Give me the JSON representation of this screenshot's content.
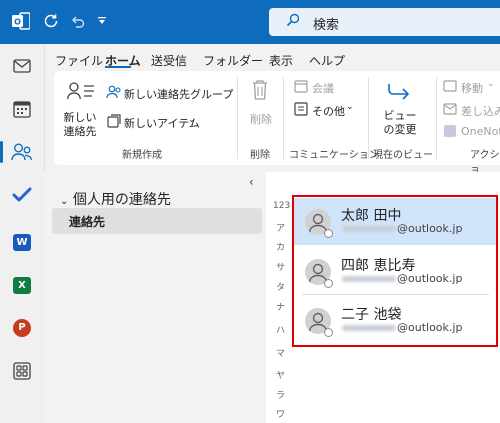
{
  "titlebar": {
    "search_label": "検索"
  },
  "menu": {
    "tabs": [
      "ファイル",
      "ホーム",
      "送受信",
      "フォルダー",
      "表示",
      "ヘルプ"
    ],
    "active": "ホーム"
  },
  "ribbon": {
    "new_contact": "新しい連絡先",
    "new_contact_group": "新しい連絡先グループ",
    "new_items": "新しいアイテム",
    "group_new": "新規作成",
    "delete": "削除",
    "group_delete": "削除",
    "meeting": "会議",
    "other": "その他",
    "group_comm": "コミュニケーション",
    "change_view": "ビューの変更",
    "group_view": "現在のビュー",
    "move": "移動",
    "mail_merge": "差し込み",
    "onenote": "OneNote",
    "group_actions": "アクショ"
  },
  "folder_pane": {
    "header": "個人用の連絡先",
    "items": [
      "連絡先"
    ]
  },
  "alphabet_index": [
    "123",
    "ア",
    "カ",
    "サ",
    "タ",
    "ナ",
    "ハ",
    "マ",
    "ヤ",
    "ラ",
    "ワ"
  ],
  "contacts": [
    {
      "name": "太郎 田中",
      "email_suffix": "@outlook.jp"
    },
    {
      "name": "四郎 恵比寿",
      "email_suffix": "@outlook.jp"
    },
    {
      "name": "二子 池袋",
      "email_suffix": "@outlook.jp"
    }
  ],
  "colors": {
    "titlebar": "#0f6cbd",
    "selection": "#cfe4fa",
    "highlight_box": "#e00000"
  },
  "icons": [
    "outlook-logo-icon",
    "sync-icon",
    "undo-icon",
    "quick-access-icon",
    "search-icon",
    "mail-icon",
    "calendar-icon",
    "people-icon",
    "todo-icon",
    "word-icon",
    "excel-icon",
    "powerpoint-icon",
    "apps-icon",
    "trash-icon",
    "meeting-icon",
    "arrow-icon"
  ]
}
